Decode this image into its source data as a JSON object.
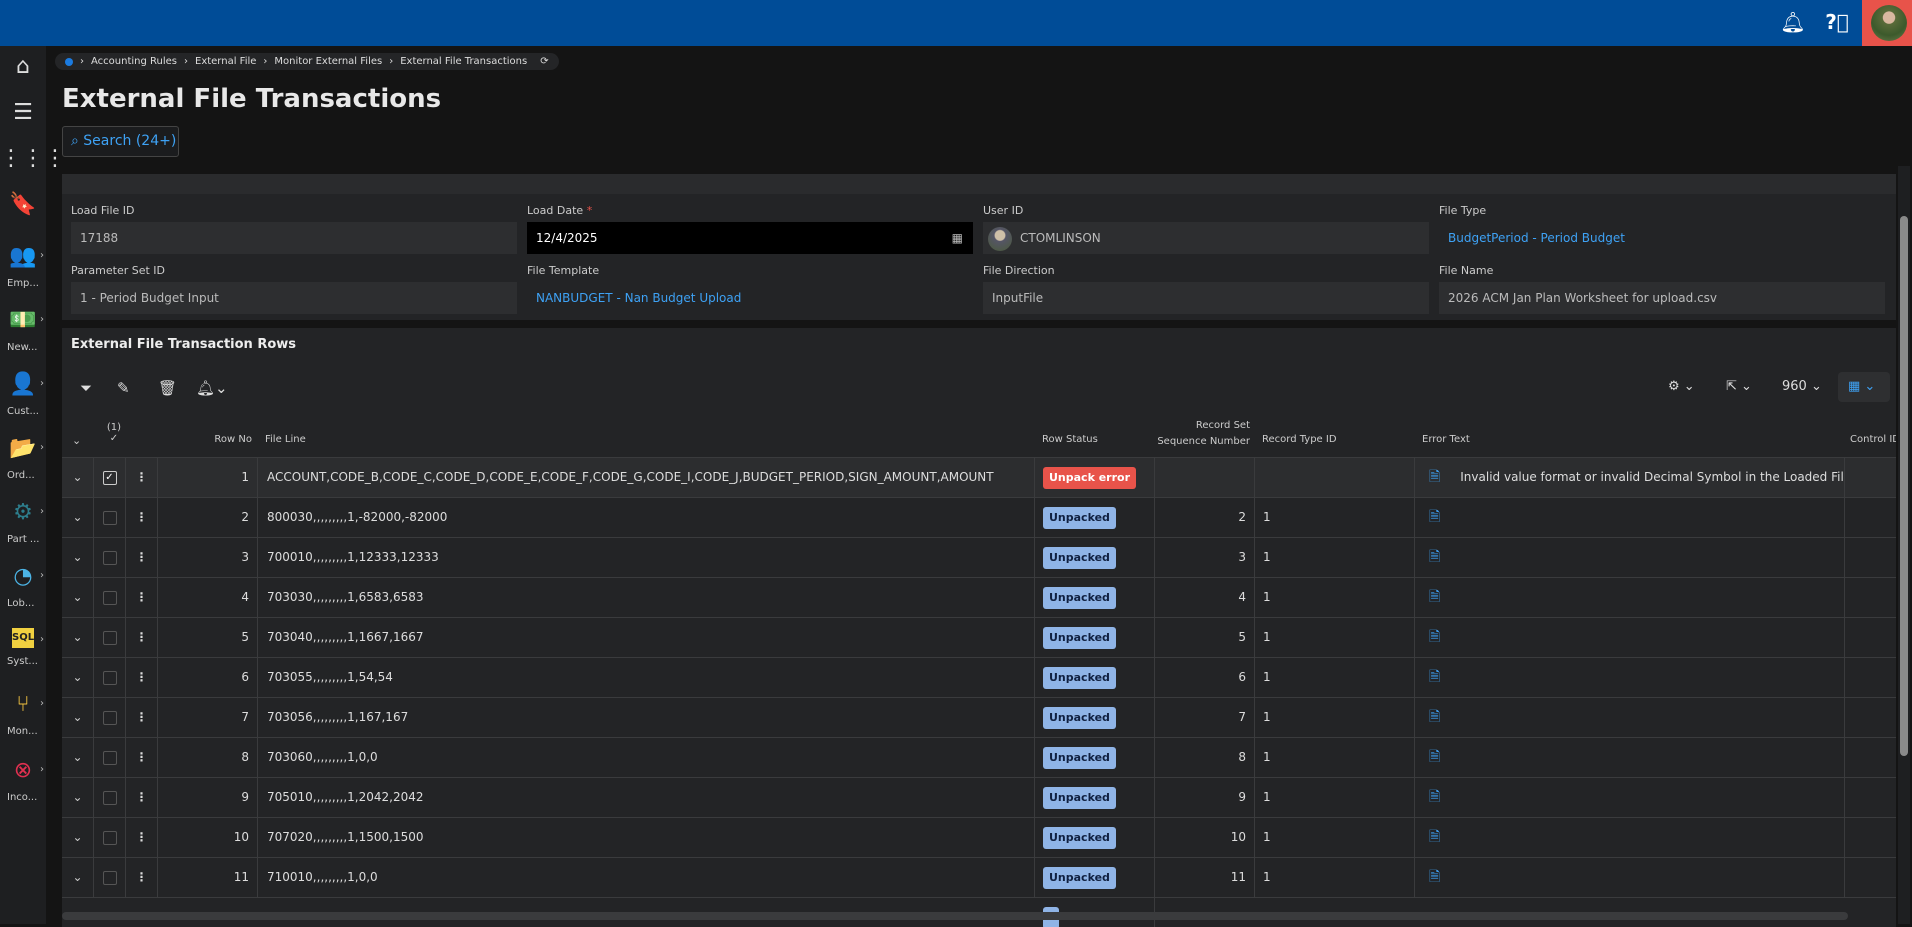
{
  "topbar": {
    "icons": [
      "bell-icon",
      "help-icon",
      "user-avatar"
    ]
  },
  "sidebar": {
    "items": [
      {
        "icon": "home-icon",
        "glyph": "⌂",
        "label": "",
        "color": "#dddddd"
      },
      {
        "icon": "menu-icon",
        "glyph": "☰",
        "label": "",
        "color": "#dddddd"
      },
      {
        "icon": "apps-icon",
        "glyph": "⋮⋮⋮",
        "label": "",
        "color": "#dddddd"
      },
      {
        "icon": "bookmark-icon",
        "glyph": "🔖",
        "label": "",
        "color": "#dddddd"
      },
      {
        "icon": "employees-icon",
        "glyph": "👥",
        "label": "Emp...",
        "color": "#e8534a"
      },
      {
        "icon": "money-icon",
        "glyph": "💵",
        "label": "New...",
        "color": "#4cd07a"
      },
      {
        "icon": "customer-icon",
        "glyph": "👤",
        "label": "Cust...",
        "color": "#e8534a"
      },
      {
        "icon": "folder-icon",
        "glyph": "📂",
        "label": "Ord...",
        "color": "#3fa66a"
      },
      {
        "icon": "gears-icon",
        "glyph": "⚙",
        "label": "Part ...",
        "color": "#2d7d8c"
      },
      {
        "icon": "pie-chart-icon",
        "glyph": "◔",
        "label": "Lob...",
        "color": "#4cb4e6"
      },
      {
        "icon": "sql-icon",
        "glyph": "SQL",
        "label": "Syst...",
        "color": "#f0d040"
      },
      {
        "icon": "flow-icon",
        "glyph": "⑂",
        "label": "Mon...",
        "color": "#f0c040"
      },
      {
        "icon": "cancel-icon",
        "glyph": "⊗",
        "label": "Inco...",
        "color": "#e03050"
      }
    ]
  },
  "breadcrumb": [
    "Accounting Rules",
    "External File",
    "Monitor External Files",
    "External File Transactions"
  ],
  "page_title": "External File Transactions",
  "search_label": "Search (24+)",
  "form": {
    "load_file_id": {
      "label": "Load File ID",
      "value": "17188"
    },
    "load_date": {
      "label": "Load Date",
      "required": "*",
      "value": "12/4/2025"
    },
    "user_id": {
      "label": "User ID",
      "value": "CTOMLINSON"
    },
    "file_type": {
      "label": "File Type",
      "value": "BudgetPeriod - Period Budget"
    },
    "parameter_set_id": {
      "label": "Parameter Set ID",
      "value": "1 - Period Budget Input"
    },
    "file_template": {
      "label": "File Template",
      "value": "NANBUDGET - Nan Budget Upload"
    },
    "file_direction": {
      "label": "File Direction",
      "value": "InputFile"
    },
    "file_name": {
      "label": "File Name",
      "value": "2026 ACM Jan Plan Worksheet for upload.csv"
    }
  },
  "grid": {
    "title": "External File Transaction Rows",
    "page_size": "960",
    "selected_count": "(1)",
    "columns": {
      "row_no": "Row No",
      "file_line": "File Line",
      "row_status": "Row Status",
      "seq_top": "Record Set",
      "seq_bottom": "Sequence Number",
      "record_type": "Record Type ID",
      "error_text": "Error Text",
      "control_id": "Control ID"
    },
    "rows": [
      {
        "row_no": "1",
        "file_line": "ACCOUNT,CODE_B,CODE_C,CODE_D,CODE_E,CODE_F,CODE_G,CODE_I,CODE_J,BUDGET_PERIOD,SIGN_AMOUNT,AMOUNT",
        "status": "Unpack error",
        "seq": "",
        "record_type": "",
        "error": "Invalid value format or invalid Decimal Symbol in the Loaded File.",
        "selected": true
      },
      {
        "row_no": "2",
        "file_line": "800030,,,,,,,,,1,-82000,-82000",
        "status": "Unpacked",
        "seq": "2",
        "record_type": "1",
        "error": ""
      },
      {
        "row_no": "3",
        "file_line": "700010,,,,,,,,,1,12333,12333",
        "status": "Unpacked",
        "seq": "3",
        "record_type": "1",
        "error": ""
      },
      {
        "row_no": "4",
        "file_line": "703030,,,,,,,,,1,6583,6583",
        "status": "Unpacked",
        "seq": "4",
        "record_type": "1",
        "error": ""
      },
      {
        "row_no": "5",
        "file_line": "703040,,,,,,,,,1,1667,1667",
        "status": "Unpacked",
        "seq": "5",
        "record_type": "1",
        "error": ""
      },
      {
        "row_no": "6",
        "file_line": "703055,,,,,,,,,1,54,54",
        "status": "Unpacked",
        "seq": "6",
        "record_type": "1",
        "error": ""
      },
      {
        "row_no": "7",
        "file_line": "703056,,,,,,,,,1,167,167",
        "status": "Unpacked",
        "seq": "7",
        "record_type": "1",
        "error": ""
      },
      {
        "row_no": "8",
        "file_line": "703060,,,,,,,,,1,0,0",
        "status": "Unpacked",
        "seq": "8",
        "record_type": "1",
        "error": ""
      },
      {
        "row_no": "9",
        "file_line": "705010,,,,,,,,,1,2042,2042",
        "status": "Unpacked",
        "seq": "9",
        "record_type": "1",
        "error": ""
      },
      {
        "row_no": "10",
        "file_line": "707020,,,,,,,,,1,1500,1500",
        "status": "Unpacked",
        "seq": "10",
        "record_type": "1",
        "error": ""
      },
      {
        "row_no": "11",
        "file_line": "710010,,,,,,,,,1,0,0",
        "status": "Unpacked",
        "seq": "11",
        "record_type": "1",
        "error": ""
      }
    ]
  },
  "colors": {
    "topbar": "#004c97",
    "accent": "#3ea2f5",
    "error": "#e8534a",
    "unpacked": "#8fb4e6"
  }
}
